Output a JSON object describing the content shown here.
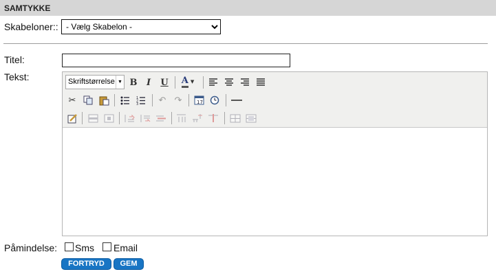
{
  "section": {
    "title": "SAMTYKKE"
  },
  "templates": {
    "label": "Skabeloner::",
    "selected": "- Vælg Skabelon -"
  },
  "title_field": {
    "label": "Titel:",
    "value": ""
  },
  "text_field": {
    "label": "Tekst:"
  },
  "editor": {
    "font_size_label": "Skriftstørrelse",
    "toolbar_row1": [
      "bold-icon",
      "italic-icon",
      "underline-icon",
      "font-color-icon",
      "align-left-icon",
      "align-center-icon",
      "align-right-icon",
      "align-justify-icon"
    ],
    "toolbar_row2": [
      "cut-icon",
      "copy-icon",
      "paste-icon",
      "bullet-list-icon",
      "numbered-list-icon",
      "undo-icon",
      "redo-icon",
      "insert-date-icon",
      "insert-time-icon",
      "horizontal-rule-icon"
    ],
    "toolbar_row3": [
      "edit-icon",
      "row-props-icon",
      "cell-props-icon",
      "insert-row-before-icon",
      "insert-row-after-icon",
      "delete-row-icon",
      "insert-col-before-icon",
      "insert-col-after-icon",
      "delete-col-icon",
      "split-cells-icon",
      "merge-cells-icon"
    ]
  },
  "reminder": {
    "label": "Påmindelse:",
    "options": [
      {
        "label": "Sms",
        "checked": false
      },
      {
        "label": "Email",
        "checked": false
      }
    ]
  },
  "actions": {
    "cancel": "FORTRYD",
    "save": "GEM"
  },
  "colors": {
    "header_bg": "#d6d6d6",
    "button_bg": "#1875c4"
  }
}
